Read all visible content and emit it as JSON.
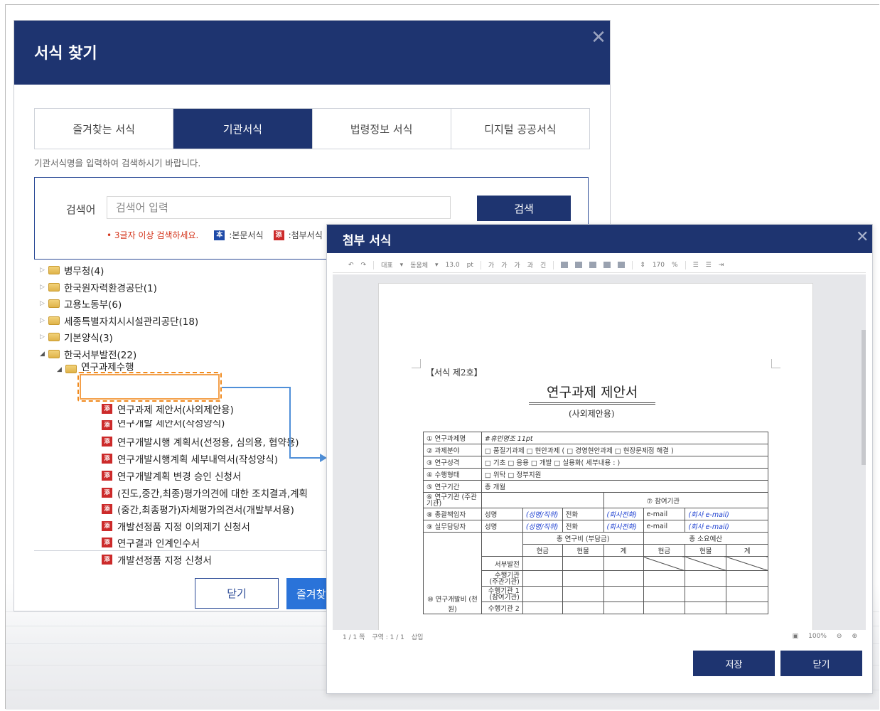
{
  "main_dialog": {
    "title": "서식 찾기",
    "tabs": [
      {
        "label": "즐겨찾는 서식",
        "active": false
      },
      {
        "label": "기관서식",
        "active": true
      },
      {
        "label": "법령정보 서식",
        "active": false
      },
      {
        "label": "디지털 공공서식",
        "active": false
      }
    ],
    "hint": "기관서식명을 입력하여 검색하시기 바랍니다.",
    "search": {
      "label": "검색어",
      "placeholder": "검색어 입력",
      "button": "검색",
      "warning": "• 3글자 이상 검색하세요.",
      "legend_body": ":본문서식",
      "legend_attach": ":첨부서식"
    },
    "tree": [
      {
        "label": "병무청(4)",
        "type": "folder",
        "expanded": false
      },
      {
        "label": "한국원자력환경공단(1)",
        "type": "folder",
        "expanded": false
      },
      {
        "label": "고용노동부(6)",
        "type": "folder",
        "expanded": false
      },
      {
        "label": "세종특별자치시시설관리공단(18)",
        "type": "folder",
        "expanded": false
      },
      {
        "label": "기본양식(3)",
        "type": "folder",
        "expanded": false
      },
      {
        "label": "한국서부발전(22)",
        "type": "folder",
        "expanded": true
      },
      {
        "label": "연구과제수행",
        "type": "folder",
        "expanded": true
      },
      {
        "label": "연구과제 제안서(사외제안용)",
        "type": "file",
        "selected": true
      },
      {
        "label": "연구개발 제안서(작성양식)",
        "type": "file"
      },
      {
        "label": "연구개발시행 계획서(선정용, 심의용, 협약용)",
        "type": "file"
      },
      {
        "label": "연구개발시행계획 세부내역서(작성양식)",
        "type": "file"
      },
      {
        "label": "연구개발계획 변경 승인 신청서",
        "type": "file"
      },
      {
        "label": "(진도,중간,최종)평가의견에 대한 조치결과,계획",
        "type": "file"
      },
      {
        "label": "(중간,최종평가)자체평가의견서(개발부서용)",
        "type": "file"
      },
      {
        "label": "개발선정품 지정 이의제기 신청서",
        "type": "file"
      },
      {
        "label": "연구결과 인계인수서",
        "type": "file"
      },
      {
        "label": "개발선정품 지정 신청서",
        "type": "file"
      }
    ],
    "buttons": {
      "close": "닫기",
      "favorite": "즐겨찾기"
    }
  },
  "attach_dialog": {
    "title": "첨부 서식",
    "toolbar": [
      "대표",
      "돋움체",
      "13.0",
      "pt",
      "가",
      "가",
      "가",
      "과",
      "긴",
      "170",
      "%"
    ],
    "document": {
      "form_no": "【서식 제2호】",
      "title": "연구과제 제안서",
      "subtitle": "(사외제안용)",
      "rows": [
        {
          "label": "① 연구과제명",
          "value": "#휴먼명조 11pt"
        },
        {
          "label": "② 과제분야",
          "value": "□ 품질기과제  □ 현안과제 ( □ 경영현안과제  □ 현장문제점 해결 )"
        },
        {
          "label": "③ 연구성격",
          "value": "□ 기초  □ 응용  □ 개발  □ 실용화( 세부내용 :                 )"
        },
        {
          "label": "④ 수행형태",
          "value": "□ 위탁  □ 정부지원"
        },
        {
          "label": "⑤ 연구기간",
          "value": "총    개월"
        },
        {
          "label": "⑥ 연구기관 (주관기관)",
          "value": "⑦ 참여기관"
        }
      ],
      "people_rows": [
        {
          "label": "⑧ 총괄책임자",
          "name_label": "성명",
          "name": "(성명/직위)",
          "tel_label": "전화",
          "tel": "(회사전화)",
          "mail_label": "e-mail",
          "mail": "(회사 e-mail)"
        },
        {
          "label": "⑨ 실무담당자",
          "name_label": "성명",
          "name": "(성명/직위)",
          "tel_label": "전화",
          "tel": "(회사전화)",
          "mail_label": "e-mail",
          "mail": "(회사 e-mail)"
        }
      ],
      "budget": {
        "label": "⑩ 연구개발비 (천원)",
        "group1": "총 연구비 (부담금)",
        "group2": "총 소요예산",
        "sub": [
          "현금",
          "현물",
          "계",
          "현금",
          "현물",
          "계"
        ],
        "row_labels": [
          "서부발전",
          "수행기관 (주관기관)",
          "수행기관 1 (참여기관)",
          "수행기관 2"
        ]
      }
    },
    "status": {
      "page": "1 / 1 쪽",
      "section": "구역 : 1 / 1",
      "mode": "삽입",
      "zoom": "100%"
    },
    "buttons": {
      "save": "저장",
      "close": "닫기"
    }
  },
  "colors": {
    "navy": "#1e3470",
    "highlight": "#f08a1e",
    "connector": "#4f8fd8"
  }
}
